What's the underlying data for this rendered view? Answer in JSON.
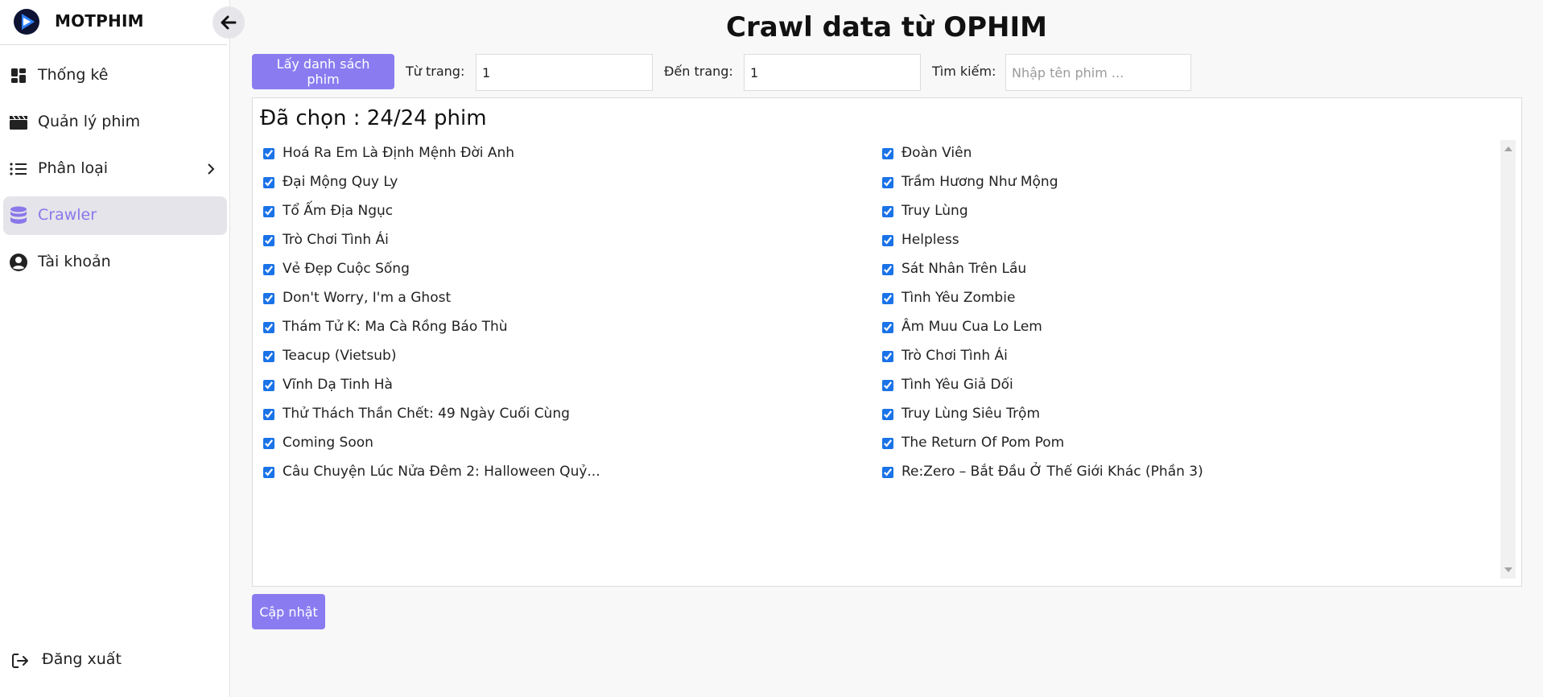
{
  "app": {
    "brand": "MOTPHIM",
    "accent": "#8a7cf0"
  },
  "sidebar": {
    "items": [
      {
        "label": "Thống kê",
        "icon": "dashboard-icon"
      },
      {
        "label": "Quản lý phim",
        "icon": "clapperboard-icon"
      },
      {
        "label": "Phân loại",
        "icon": "list-icon"
      },
      {
        "label": "Crawler",
        "icon": "database-icon",
        "active": true
      },
      {
        "label": "Tài khoản",
        "icon": "user-circle-icon"
      }
    ],
    "logout": "Đăng xuất"
  },
  "page": {
    "title": "Crawl data từ OPHIM"
  },
  "toolbar": {
    "fetch_label": "Lấy danh sách phim",
    "from_label": "Từ trang:",
    "from_value": "1",
    "to_label": "Đến trang:",
    "to_value": "1",
    "search_label": "Tìm kiếm:",
    "search_placeholder": "Nhập tên phim ..."
  },
  "selection": {
    "summary": "Đã chọn : 24/24 phim",
    "left": [
      "Hoá Ra Em Là Định Mệnh Đời Anh",
      "Đại Mộng Quy Ly",
      "Tổ Ấm Địa Ngục",
      "Trò Chơi Tình Ái",
      "Vẻ Đẹp Cuộc Sống",
      "Don't Worry, I'm a Ghost",
      "Thám Tử K: Ma Cà Rồng Báo Thù",
      "Teacup (Vietsub)",
      "Vĩnh Dạ Tinh Hà",
      "Thử Thách Thần Chết: 49 Ngày Cuối Cùng",
      "Coming Soon",
      "Câu Chuyện Lúc Nửa Đêm 2: Halloween Quỷ..."
    ],
    "right": [
      "Đoàn Viên",
      "Trầm Hương Như Mộng",
      "Truy Lùng",
      "Helpless",
      "Sát Nhân Trên Lầu",
      "Tình Yêu Zombie",
      "Âm Muu Cua Lo Lem",
      "Trò Chơi Tình Ái",
      "Tình Yêu Giả Dối",
      "Truy Lùng Siêu Trộm",
      "The Return Of Pom Pom",
      "Re:Zero – Bắt Đầu Ở Thế Giới Khác (Phần 3)"
    ]
  },
  "actions": {
    "update_label": "Cập nhật"
  }
}
